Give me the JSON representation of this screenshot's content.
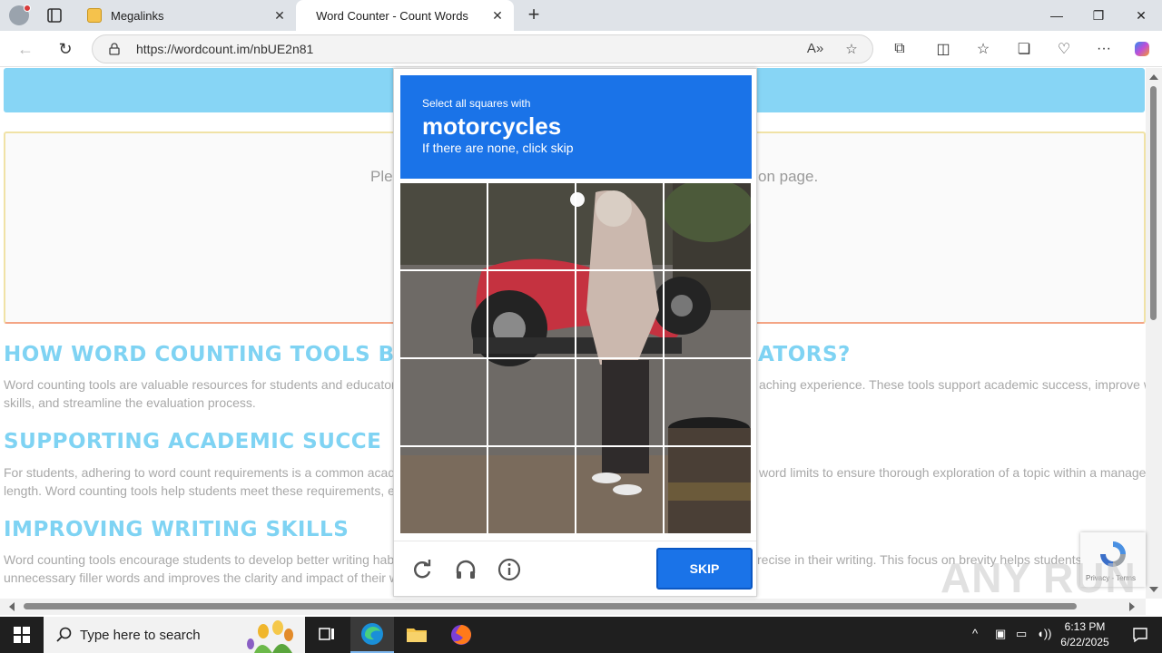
{
  "browser": {
    "tabs": [
      {
        "title": "Megalinks",
        "active": false
      },
      {
        "title": "Word Counter - Count Words",
        "active": true
      }
    ],
    "url": "https://wordcount.im/nbUE2n81"
  },
  "page": {
    "input_placeholder_left": "Ple",
    "input_placeholder_right": "on page.",
    "sections": [
      {
        "heading_left": "HOW WORD COUNTING TOOLS B",
        "heading_right": "ATORS?",
        "line1_left": "Word counting tools are valuable resources for students and educator",
        "line1_right": "aching experience. These tools support academic success, improve w",
        "line2_left": "skills, and streamline the evaluation process."
      },
      {
        "heading_left": "SUPPORTING ACADEMIC SUCCE",
        "line1_left": "For students, adhering to word count requirements is a common acad",
        "line1_right": "word limits to ensure thorough exploration of a topic within a manage",
        "line2_left": "length. Word counting tools help students meet these requirements, e"
      },
      {
        "heading_left": "IMPROVING WRITING SKILLS",
        "line1_left": "Word counting tools encourage students to develop better writing hab",
        "line1_right": "recise in their writing. This focus on brevity helps students",
        "line2_left": "unnecessary filler words and improves the clarity and impact of their w"
      }
    ]
  },
  "captcha": {
    "instruction": "Select all squares with",
    "target": "motorcycles",
    "hint": "If there are none, click skip",
    "skip_label": "SKIP",
    "grid_rows": 4,
    "grid_cols": 4
  },
  "recaptcha_badge": {
    "text": "Privacy - Terms"
  },
  "watermark": "ANY RUN",
  "taskbar": {
    "search_placeholder": "Type here to search",
    "time": "6:13 PM",
    "date": "6/22/2025"
  },
  "colors": {
    "accent": "#1a73e8",
    "banner": "#87d5f5",
    "heading": "#7fd3f3"
  }
}
